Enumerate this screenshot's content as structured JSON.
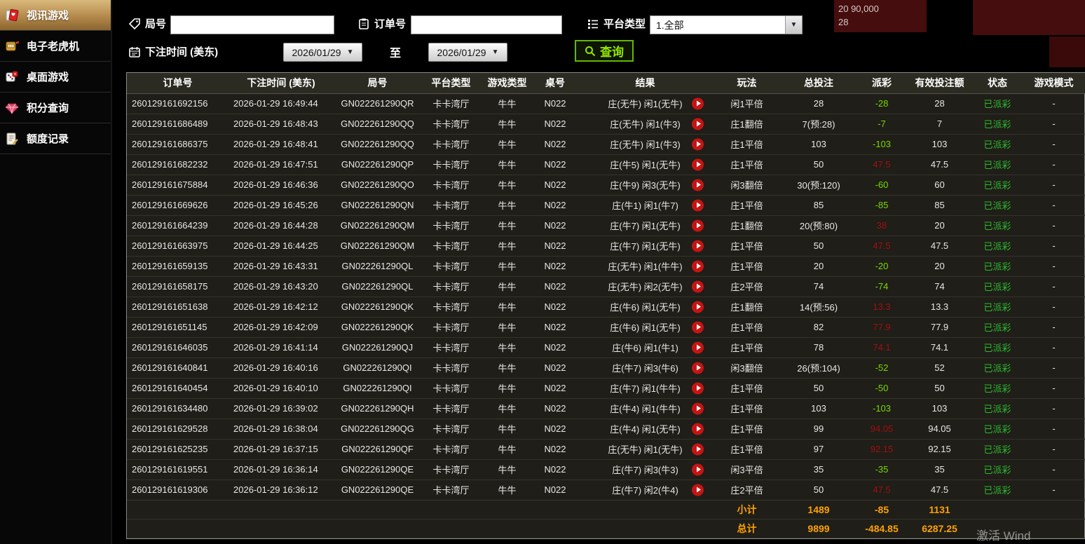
{
  "sidebar": {
    "items": [
      {
        "label": "视讯游戏",
        "icon": "cards-icon",
        "active": true
      },
      {
        "label": "电子老虎机",
        "icon": "slot-machine-icon",
        "active": false
      },
      {
        "label": "桌面游戏",
        "icon": "dice-icon",
        "active": false
      },
      {
        "label": "积分查询",
        "icon": "gem-icon",
        "active": false
      },
      {
        "label": "额度记录",
        "icon": "document-icon",
        "active": false
      }
    ]
  },
  "filters": {
    "round_label": "局号",
    "round_value": "",
    "order_label": "订单号",
    "order_value": "",
    "platform_label": "平台类型",
    "platform_value": "1.全部",
    "bet_time_label": "下注时间 (美东)",
    "date_from": "2026/01/29",
    "date_to": "2026/01/29",
    "to_label": "至",
    "search_label": "查询"
  },
  "fragments": {
    "line1": "20  90,000",
    "line2": "28"
  },
  "watermark": "激活 Wind",
  "colors": {
    "payout_negative": "#79d900",
    "payout_positive": "#a01010",
    "status_green": "#2eb82e",
    "summary_orange": "#ffa200",
    "active_menu_gold": "#b4894b",
    "play_icon_red": "#c61414"
  },
  "table": {
    "headers": [
      "订单号",
      "下注时间 (美东)",
      "局号",
      "平台类型",
      "游戏类型",
      "桌号",
      "结果",
      "玩法",
      "总投注",
      "派彩",
      "有效投注额",
      "状态",
      "游戏模式"
    ],
    "rows": [
      {
        "order": "260129161692156",
        "time": "2026-01-29 16:49:44",
        "round": "GN022261290QR",
        "platform": "卡卡湾厅",
        "game": "牛牛",
        "table_no": "N022",
        "result": "庄(无牛) 闲1(无牛)",
        "bet_type": "闲1平倍",
        "total_bet": "28",
        "payout": "-28",
        "valid_bet": "28",
        "status": "已派彩",
        "mode": "-"
      },
      {
        "order": "260129161686489",
        "time": "2026-01-29 16:48:43",
        "round": "GN022261290QQ",
        "platform": "卡卡湾厅",
        "game": "牛牛",
        "table_no": "N022",
        "result": "庄(无牛) 闲1(牛3)",
        "bet_type": "庄1翻倍",
        "total_bet": "7(预:28)",
        "payout": "-7",
        "valid_bet": "7",
        "status": "已派彩",
        "mode": "-"
      },
      {
        "order": "260129161686375",
        "time": "2026-01-29 16:48:41",
        "round": "GN022261290QQ",
        "platform": "卡卡湾厅",
        "game": "牛牛",
        "table_no": "N022",
        "result": "庄(无牛) 闲1(牛3)",
        "bet_type": "庄1平倍",
        "total_bet": "103",
        "payout": "-103",
        "valid_bet": "103",
        "status": "已派彩",
        "mode": "-"
      },
      {
        "order": "260129161682232",
        "time": "2026-01-29 16:47:51",
        "round": "GN022261290QP",
        "platform": "卡卡湾厅",
        "game": "牛牛",
        "table_no": "N022",
        "result": "庄(牛5) 闲1(无牛)",
        "bet_type": "庄1平倍",
        "total_bet": "50",
        "payout": "47.5",
        "valid_bet": "47.5",
        "status": "已派彩",
        "mode": "-"
      },
      {
        "order": "260129161675884",
        "time": "2026-01-29 16:46:36",
        "round": "GN022261290QO",
        "platform": "卡卡湾厅",
        "game": "牛牛",
        "table_no": "N022",
        "result": "庄(牛9) 闲3(无牛)",
        "bet_type": "闲3翻倍",
        "total_bet": "30(预:120)",
        "payout": "-60",
        "valid_bet": "60",
        "status": "已派彩",
        "mode": "-"
      },
      {
        "order": "260129161669626",
        "time": "2026-01-29 16:45:26",
        "round": "GN022261290QN",
        "platform": "卡卡湾厅",
        "game": "牛牛",
        "table_no": "N022",
        "result": "庄(牛1) 闲1(牛7)",
        "bet_type": "庄1平倍",
        "total_bet": "85",
        "payout": "-85",
        "valid_bet": "85",
        "status": "已派彩",
        "mode": "-"
      },
      {
        "order": "260129161664239",
        "time": "2026-01-29 16:44:28",
        "round": "GN022261290QM",
        "platform": "卡卡湾厅",
        "game": "牛牛",
        "table_no": "N022",
        "result": "庄(牛7) 闲1(无牛)",
        "bet_type": "庄1翻倍",
        "total_bet": "20(预:80)",
        "payout": "38",
        "valid_bet": "20",
        "status": "已派彩",
        "mode": "-"
      },
      {
        "order": "260129161663975",
        "time": "2026-01-29 16:44:25",
        "round": "GN022261290QM",
        "platform": "卡卡湾厅",
        "game": "牛牛",
        "table_no": "N022",
        "result": "庄(牛7) 闲1(无牛)",
        "bet_type": "庄1平倍",
        "total_bet": "50",
        "payout": "47.5",
        "valid_bet": "47.5",
        "status": "已派彩",
        "mode": "-"
      },
      {
        "order": "260129161659135",
        "time": "2026-01-29 16:43:31",
        "round": "GN022261290QL",
        "platform": "卡卡湾厅",
        "game": "牛牛",
        "table_no": "N022",
        "result": "庄(无牛) 闲1(牛牛)",
        "bet_type": "庄1平倍",
        "total_bet": "20",
        "payout": "-20",
        "valid_bet": "20",
        "status": "已派彩",
        "mode": "-"
      },
      {
        "order": "260129161658175",
        "time": "2026-01-29 16:43:20",
        "round": "GN022261290QL",
        "platform": "卡卡湾厅",
        "game": "牛牛",
        "table_no": "N022",
        "result": "庄(无牛) 闲2(无牛)",
        "bet_type": "庄2平倍",
        "total_bet": "74",
        "payout": "-74",
        "valid_bet": "74",
        "status": "已派彩",
        "mode": "-"
      },
      {
        "order": "260129161651638",
        "time": "2026-01-29 16:42:12",
        "round": "GN022261290QK",
        "platform": "卡卡湾厅",
        "game": "牛牛",
        "table_no": "N022",
        "result": "庄(牛6) 闲1(无牛)",
        "bet_type": "庄1翻倍",
        "total_bet": "14(预:56)",
        "payout": "13.3",
        "valid_bet": "13.3",
        "status": "已派彩",
        "mode": "-"
      },
      {
        "order": "260129161651145",
        "time": "2026-01-29 16:42:09",
        "round": "GN022261290QK",
        "platform": "卡卡湾厅",
        "game": "牛牛",
        "table_no": "N022",
        "result": "庄(牛6) 闲1(无牛)",
        "bet_type": "庄1平倍",
        "total_bet": "82",
        "payout": "77.9",
        "valid_bet": "77.9",
        "status": "已派彩",
        "mode": "-"
      },
      {
        "order": "260129161646035",
        "time": "2026-01-29 16:41:14",
        "round": "GN022261290QJ",
        "platform": "卡卡湾厅",
        "game": "牛牛",
        "table_no": "N022",
        "result": "庄(牛6) 闲1(牛1)",
        "bet_type": "庄1平倍",
        "total_bet": "78",
        "payout": "74.1",
        "valid_bet": "74.1",
        "status": "已派彩",
        "mode": "-"
      },
      {
        "order": "260129161640841",
        "time": "2026-01-29 16:40:16",
        "round": "GN022261290QI",
        "platform": "卡卡湾厅",
        "game": "牛牛",
        "table_no": "N022",
        "result": "庄(牛7) 闲3(牛6)",
        "bet_type": "闲3翻倍",
        "total_bet": "26(预:104)",
        "payout": "-52",
        "valid_bet": "52",
        "status": "已派彩",
        "mode": "-"
      },
      {
        "order": "260129161640454",
        "time": "2026-01-29 16:40:10",
        "round": "GN022261290QI",
        "platform": "卡卡湾厅",
        "game": "牛牛",
        "table_no": "N022",
        "result": "庄(牛7) 闲1(牛牛)",
        "bet_type": "庄1平倍",
        "total_bet": "50",
        "payout": "-50",
        "valid_bet": "50",
        "status": "已派彩",
        "mode": "-"
      },
      {
        "order": "260129161634480",
        "time": "2026-01-29 16:39:02",
        "round": "GN022261290QH",
        "platform": "卡卡湾厅",
        "game": "牛牛",
        "table_no": "N022",
        "result": "庄(牛4) 闲1(牛牛)",
        "bet_type": "庄1平倍",
        "total_bet": "103",
        "payout": "-103",
        "valid_bet": "103",
        "status": "已派彩",
        "mode": "-"
      },
      {
        "order": "260129161629528",
        "time": "2026-01-29 16:38:04",
        "round": "GN022261290QG",
        "platform": "卡卡湾厅",
        "game": "牛牛",
        "table_no": "N022",
        "result": "庄(牛4) 闲1(无牛)",
        "bet_type": "庄1平倍",
        "total_bet": "99",
        "payout": "94.05",
        "valid_bet": "94.05",
        "status": "已派彩",
        "mode": "-"
      },
      {
        "order": "260129161625235",
        "time": "2026-01-29 16:37:15",
        "round": "GN022261290QF",
        "platform": "卡卡湾厅",
        "game": "牛牛",
        "table_no": "N022",
        "result": "庄(无牛) 闲1(无牛)",
        "bet_type": "庄1平倍",
        "total_bet": "97",
        "payout": "92.15",
        "valid_bet": "92.15",
        "status": "已派彩",
        "mode": "-"
      },
      {
        "order": "260129161619551",
        "time": "2026-01-29 16:36:14",
        "round": "GN022261290QE",
        "platform": "卡卡湾厅",
        "game": "牛牛",
        "table_no": "N022",
        "result": "庄(牛7) 闲3(牛3)",
        "bet_type": "闲3平倍",
        "total_bet": "35",
        "payout": "-35",
        "valid_bet": "35",
        "status": "已派彩",
        "mode": "-"
      },
      {
        "order": "260129161619306",
        "time": "2026-01-29 16:36:12",
        "round": "GN022261290QE",
        "platform": "卡卡湾厅",
        "game": "牛牛",
        "table_no": "N022",
        "result": "庄(牛7) 闲2(牛4)",
        "bet_type": "庄2平倍",
        "total_bet": "50",
        "payout": "47.5",
        "valid_bet": "47.5",
        "status": "已派彩",
        "mode": "-"
      }
    ],
    "subtotal": {
      "label": "小计",
      "total_bet": "1489",
      "payout": "-85",
      "valid_bet": "1131"
    },
    "total": {
      "label": "总计",
      "total_bet": "9899",
      "payout": "-484.85",
      "valid_bet": "6287.25"
    }
  }
}
